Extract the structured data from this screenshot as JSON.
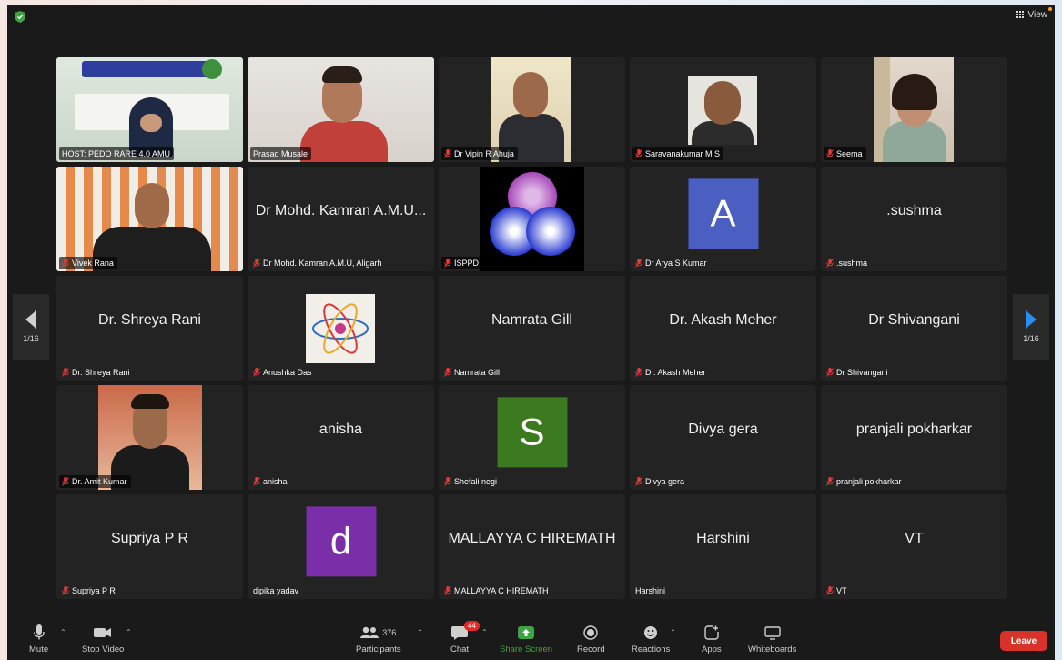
{
  "topbar": {
    "view_label": "View"
  },
  "pagination": {
    "left_label": "1/16",
    "right_label": "1/16"
  },
  "tiles": [
    {
      "name": "HOST: PEDO RARE 4.0 AMU",
      "muted": false,
      "plain": false,
      "kind": "video"
    },
    {
      "name": "Prasad Musale",
      "muted": false,
      "plain": false,
      "kind": "video"
    },
    {
      "name": "Dr Vipin R Ahuja",
      "muted": true,
      "plain": false,
      "kind": "video"
    },
    {
      "name": "Saravanakumar M S",
      "muted": true,
      "plain": false,
      "kind": "video"
    },
    {
      "name": "Seema",
      "muted": true,
      "plain": false,
      "kind": "video"
    },
    {
      "name": "Vivek Rana",
      "muted": true,
      "plain": false,
      "kind": "video"
    },
    {
      "name": "Dr Mohd. Kamran A.M.U, Aligarh",
      "center": "Dr Mohd. Kamran A.M.U...",
      "muted": true,
      "plain": true,
      "kind": "name"
    },
    {
      "name": "ISPPD",
      "muted": true,
      "plain": false,
      "kind": "logo"
    },
    {
      "name": "Dr Arya S Kumar",
      "muted": true,
      "plain": true,
      "kind": "avatar",
      "letter": "A",
      "color": "#4a5fc1"
    },
    {
      "name": ".sushma",
      "center": ".sushma",
      "muted": true,
      "plain": true,
      "kind": "name"
    },
    {
      "name": "Dr. Shreya Rani",
      "center": "Dr. Shreya Rani",
      "muted": true,
      "plain": true,
      "kind": "name"
    },
    {
      "name": "Anushka Das",
      "muted": true,
      "plain": true,
      "kind": "atom"
    },
    {
      "name": "Namrata Gill",
      "center": "Namrata Gill",
      "muted": true,
      "plain": true,
      "kind": "name"
    },
    {
      "name": "Dr. Akash Meher",
      "center": "Dr. Akash Meher",
      "muted": true,
      "plain": true,
      "kind": "name"
    },
    {
      "name": "Dr Shivangani",
      "center": "Dr Shivangani",
      "muted": true,
      "plain": true,
      "kind": "name"
    },
    {
      "name": "Dr. Amit Kumar",
      "muted": true,
      "plain": false,
      "kind": "video"
    },
    {
      "name": "anisha",
      "center": "anisha",
      "muted": true,
      "plain": true,
      "kind": "name"
    },
    {
      "name": "Shefali negi",
      "muted": true,
      "plain": true,
      "kind": "avatar",
      "letter": "S",
      "color": "#3b7a1e"
    },
    {
      "name": "Divya gera",
      "center": "Divya gera",
      "muted": true,
      "plain": true,
      "kind": "name"
    },
    {
      "name": "pranjali pokharkar",
      "center": "pranjali pokharkar",
      "muted": true,
      "plain": true,
      "kind": "name"
    },
    {
      "name": "Supriya P R",
      "center": "Supriya P R",
      "muted": true,
      "plain": true,
      "kind": "name"
    },
    {
      "name": "dipika yadav",
      "muted": false,
      "plain": true,
      "kind": "avatar",
      "letter": "d",
      "color": "#7a2ea8"
    },
    {
      "name": "MALLAYYA C HIREMATH",
      "center": "MALLAYYA C HIREMATH",
      "muted": true,
      "plain": true,
      "kind": "name"
    },
    {
      "name": "Harshini",
      "center": "Harshini",
      "muted": false,
      "plain": true,
      "kind": "name"
    },
    {
      "name": "VT",
      "center": "VT",
      "muted": true,
      "plain": true,
      "kind": "name"
    }
  ],
  "toolbar": {
    "mute_label": "Mute",
    "stop_video_label": "Stop Video",
    "participants_label": "Participants",
    "participants_count": "376",
    "chat_label": "Chat",
    "chat_badge": "44",
    "share_screen_label": "Share Screen",
    "record_label": "Record",
    "reactions_label": "Reactions",
    "apps_label": "Apps",
    "whiteboards_label": "Whiteboards",
    "leave_label": "Leave"
  },
  "colors": {
    "accent_green": "#3ea443",
    "leave_red": "#d8332a",
    "nav_blue": "#2d8cf0"
  }
}
